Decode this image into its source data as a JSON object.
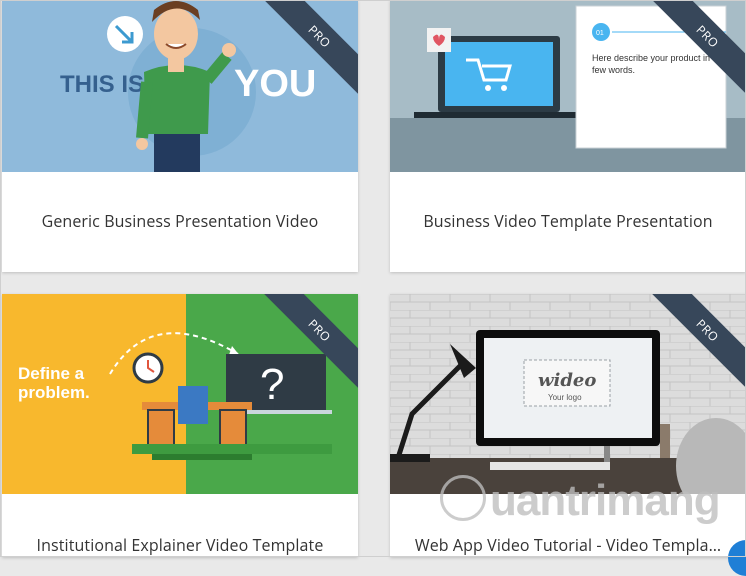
{
  "cards": [
    {
      "title": "Generic Business Presentation Video",
      "badge": "PRO",
      "thumb_text_left": "THIS IS",
      "thumb_text_right": "YOU"
    },
    {
      "title": "Business Video Template Presentation",
      "badge": "PRO",
      "step_number": "01",
      "thumb_text": "Here describe your product in a few words."
    },
    {
      "title": "Institutional Explainer Video Template",
      "badge": "PRO",
      "thumb_text": "Define a problem."
    },
    {
      "title": "Web App Video Tutorial - Video Templa…",
      "badge": "PRO",
      "logo_text": "wideo",
      "logo_subtext": "Your logo"
    }
  ],
  "watermark": {
    "text": "uantrimang"
  },
  "colors": {
    "pro_ribbon": "#37475a",
    "card_bg": "#ffffff",
    "page_bg": "#e9e9e9",
    "title_text": "#333333"
  }
}
